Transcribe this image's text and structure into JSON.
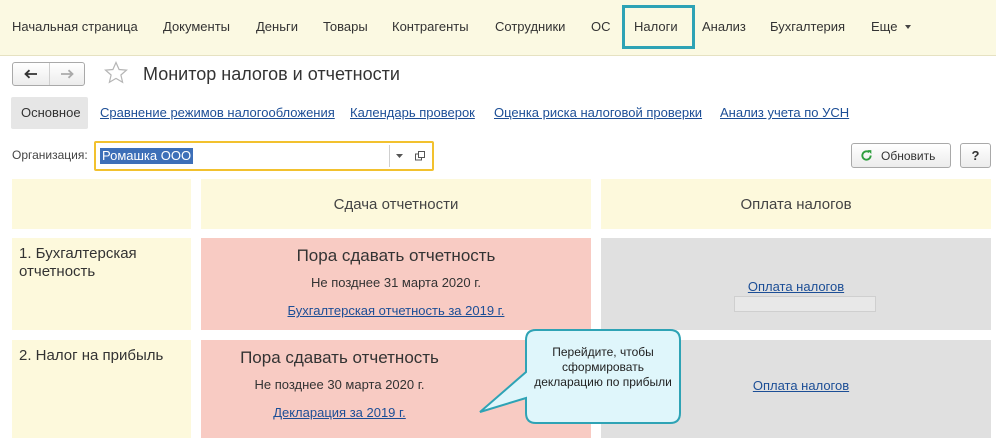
{
  "topnav": {
    "items": [
      "Начальная страница",
      "Документы",
      "Деньги",
      "Товары",
      "Контрагенты",
      "Сотрудники",
      "ОС",
      "Налоги",
      "Анализ",
      "Бухгалтерия",
      "Еще"
    ],
    "active": "Налоги"
  },
  "page": {
    "title": "Монитор налогов и отчетности"
  },
  "tabs": {
    "active": "Основное",
    "links": [
      "Сравнение режимов налогообложения",
      "Календарь проверок",
      "Оценка риска налоговой проверки",
      "Анализ учета по УСН"
    ]
  },
  "org": {
    "label": "Организация:",
    "value": "Ромашка ООО"
  },
  "buttons": {
    "refresh": "Обновить",
    "help": "?"
  },
  "grid": {
    "col_reports": "Сдача отчетности",
    "col_payments": "Оплата налогов",
    "rows": [
      {
        "label": "1. Бухгалтерская отчетность",
        "status": "Пора сдавать отчетность",
        "deadline": "Не позднее 31 марта 2020 г.",
        "report_link": "Бухгалтерская отчетность за 2019 г.",
        "payment_link": "Оплата налогов"
      },
      {
        "label": "2. Налог на прибыль",
        "status": "Пора сдавать отчетность",
        "deadline": "Не позднее 30 марта 2020 г.",
        "report_link": "Декларация за 2019 г.",
        "payment_link": "Оплата налогов"
      }
    ]
  },
  "callout": {
    "text": "Перейдите, чтобы сформировать декларацию по прибыли"
  },
  "colors": {
    "accent": "#2ea3b5",
    "highlight": "#f2c12e",
    "link": "#1c4e96",
    "due": "#f8cbc3",
    "header": "#fdf9dc",
    "callout_fill": "#dff6fb"
  }
}
